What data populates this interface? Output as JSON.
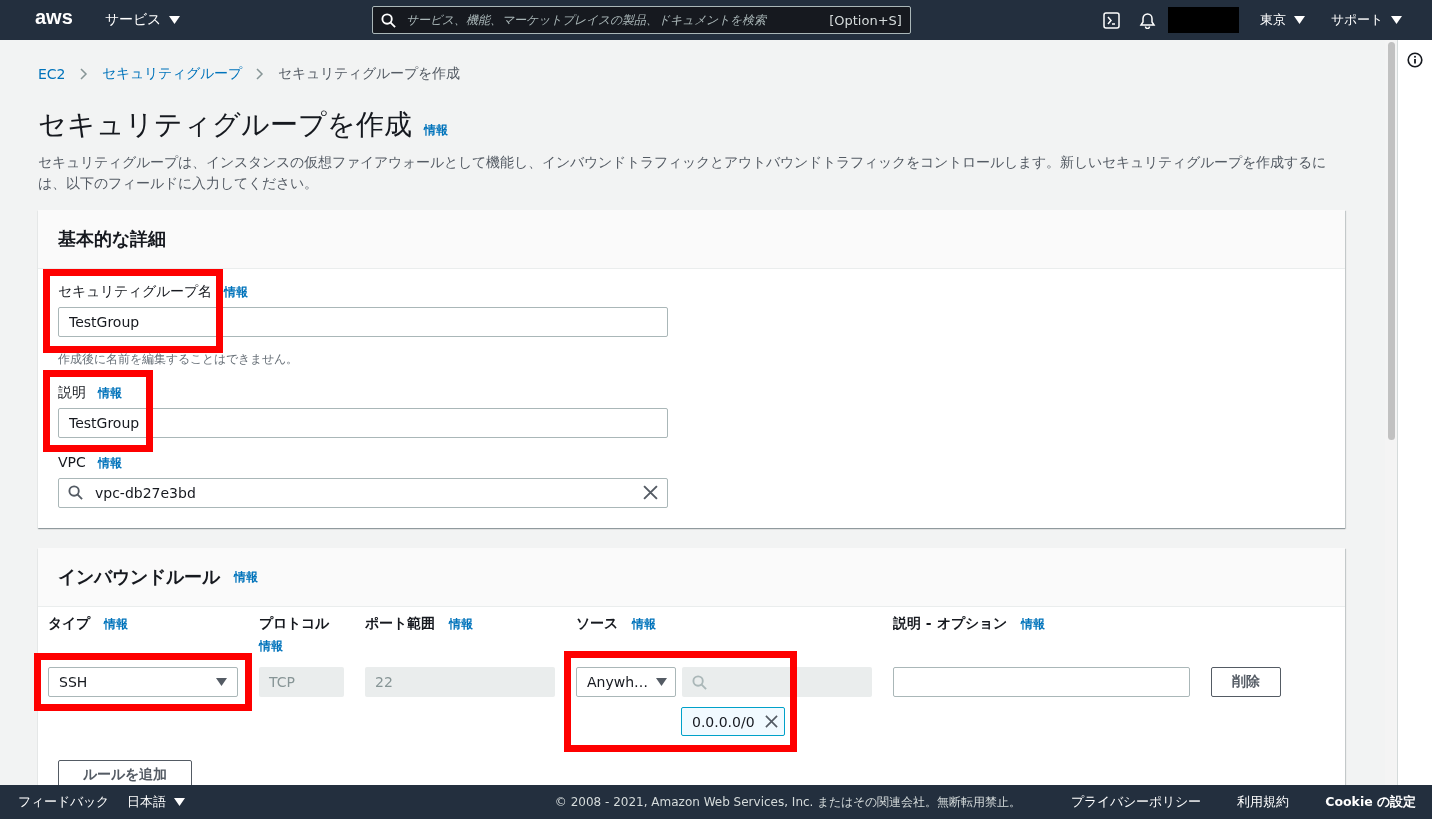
{
  "nav": {
    "logo": "aws",
    "services": "サービス",
    "search_placeholder": "サービス、機能、マーケットプレイスの製品、ドキュメントを検索",
    "search_shortcut": "[Option+S]",
    "region": "東京",
    "support": "サポート"
  },
  "breadcrumbs": [
    {
      "label": "EC2",
      "link": true
    },
    {
      "label": "セキュリティグループ",
      "link": true
    },
    {
      "label": "セキュリティグループを作成",
      "link": false
    }
  ],
  "page": {
    "title": "セキュリティグループを作成",
    "info": "情報",
    "description": "セキュリティグループは、インスタンスの仮想ファイアウォールとして機能し、インバウンドトラフィックとアウトバウンドトラフィックをコントロールします。新しいセキュリティグループを作成するには、以下のフィールドに入力してください。"
  },
  "basic": {
    "title": "基本的な詳細",
    "fields": [
      {
        "kind": "text",
        "label": "セキュリティグループ名",
        "info": "情報",
        "value": "TestGroup",
        "hint": "作成後に名前を編集することはできません。",
        "highlighted": true
      },
      {
        "kind": "text",
        "label": "説明",
        "info": "情報",
        "value": "TestGroup",
        "highlighted": true
      },
      {
        "kind": "search",
        "label": "VPC",
        "info": "情報",
        "value": "vpc-db27e3bd",
        "highlighted": false
      }
    ]
  },
  "inbound": {
    "title": "インバウンドルール",
    "info": "情報",
    "columns": [
      {
        "label": "タイプ",
        "info": "情報"
      },
      {
        "label": "プロトコル",
        "info": "情報"
      },
      {
        "label": "ポート範囲",
        "info": "情報"
      },
      {
        "label": "ソース",
        "info": "情報"
      },
      {
        "label": "説明 - オプション",
        "info": "情報"
      }
    ],
    "rules": [
      {
        "type": "SSH",
        "type_highlighted": true,
        "protocol": "TCP",
        "port": "22",
        "source": "Anywh…",
        "source_highlighted": true,
        "cidr": "0.0.0.0/0",
        "delete": "削除"
      }
    ],
    "add_button": "ルールを追加"
  },
  "footer": {
    "feedback": "フィードバック",
    "language": "日本語",
    "copyright": "© 2008 - 2021, Amazon Web Services, Inc. またはその関連会社。無断転用禁止。",
    "links": [
      "プライバシーポリシー",
      "利用規約",
      "Cookie の設定"
    ]
  }
}
